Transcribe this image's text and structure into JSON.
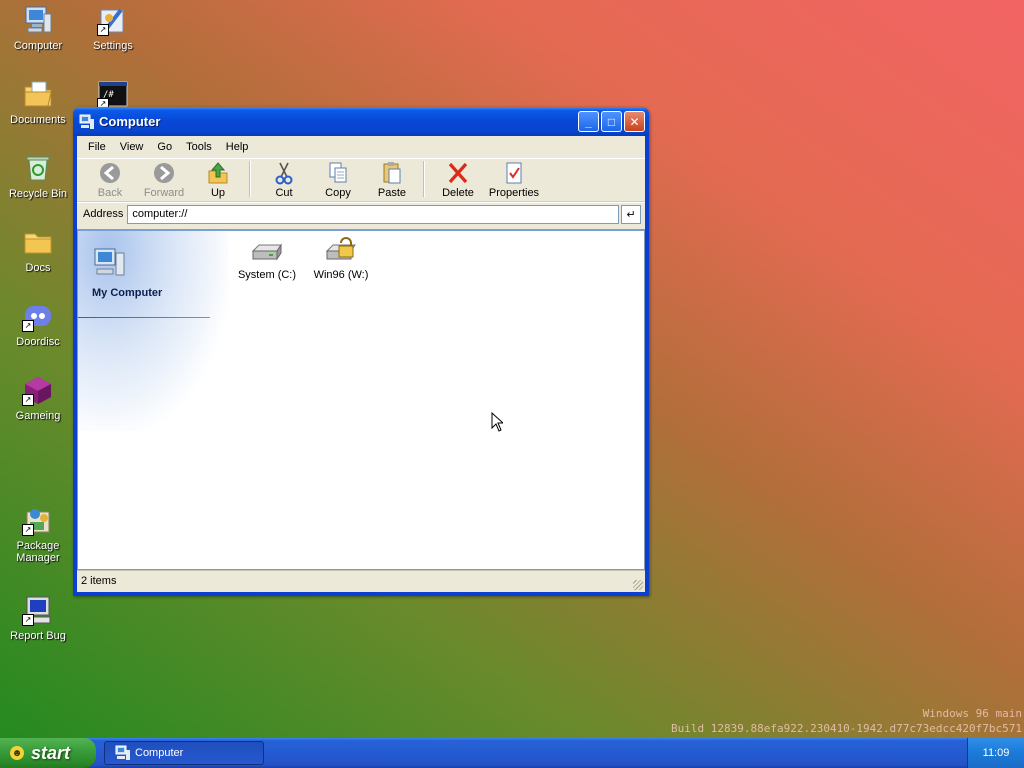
{
  "desktop": {
    "icons": [
      {
        "label": "Computer",
        "icon": "computer-icon",
        "shortcut": false
      },
      {
        "label": "Settings",
        "icon": "settings-icon",
        "shortcut": true
      },
      {
        "label": "Documents",
        "icon": "documents-icon",
        "shortcut": false
      },
      {
        "label": "",
        "icon": "terminal-icon",
        "shortcut": true
      },
      {
        "label": "Recycle Bin",
        "icon": "recycle-bin-icon",
        "shortcut": false
      },
      {
        "label": "Docs",
        "icon": "folder-icon",
        "shortcut": false
      },
      {
        "label": "Doordisc",
        "icon": "discord-icon",
        "shortcut": true
      },
      {
        "label": "Gameing",
        "icon": "game-icon",
        "shortcut": true
      },
      {
        "label": "Package Manager",
        "icon": "package-manager-icon",
        "shortcut": true
      },
      {
        "label": "Report Bug",
        "icon": "report-bug-icon",
        "shortcut": true
      }
    ],
    "terminal_icon_text": "/#"
  },
  "window": {
    "title": "Computer",
    "controls": {
      "minimize": "_",
      "maximize": "□",
      "close": "✕"
    },
    "menu": [
      "File",
      "View",
      "Go",
      "Tools",
      "Help"
    ],
    "toolbar": {
      "back": "Back",
      "forward": "Forward",
      "up": "Up",
      "cut": "Cut",
      "copy": "Copy",
      "paste": "Paste",
      "delete": "Delete",
      "properties": "Properties"
    },
    "address": {
      "label": "Address",
      "value": "computer://",
      "go_glyph": "↵"
    },
    "sidebar": {
      "title": "My Computer"
    },
    "items": [
      {
        "label": "System (C:)",
        "icon": "hard-drive-icon"
      },
      {
        "label": "Win96 (W:)",
        "icon": "locked-drive-icon"
      }
    ],
    "status": "2 items"
  },
  "taskbar": {
    "start_label": "start",
    "start_logo_glyph": "☻",
    "tasks": [
      {
        "label": "Computer"
      }
    ],
    "clock": "11:09"
  },
  "watermark": {
    "line1": "Windows 96 main",
    "line2": "Build 12839.88efa922.230410-1942.d77c73edcc420f7bc571"
  },
  "colors": {
    "title_blue": "#0847d6",
    "start_green": "#3b9d3b",
    "taskbar_blue": "#245ad1",
    "window_face": "#ece9d8"
  }
}
